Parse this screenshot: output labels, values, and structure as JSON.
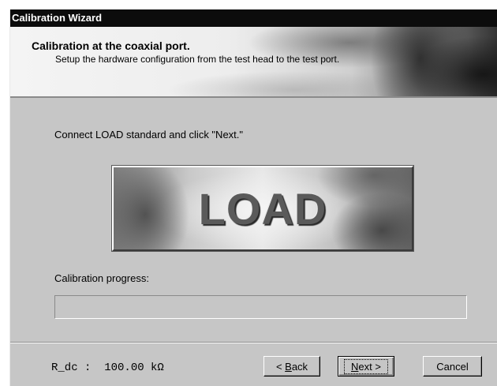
{
  "window": {
    "title": "Calibration Wizard"
  },
  "header": {
    "title": "Calibration at the coaxial port.",
    "subtitle": "Setup the hardware configuration from the test head to the test port."
  },
  "main": {
    "instruction": "Connect LOAD standard and click \"Next.\"",
    "standard_image_text": "LOAD",
    "progress_label": "Calibration progress:",
    "progress_value": 0
  },
  "footer": {
    "status_text": "R_dc :  100.00 kΩ",
    "back_label_prefix": "< ",
    "back_label_key": "B",
    "back_label_rest": "ack",
    "next_label_key": "N",
    "next_label_rest": "ext >",
    "cancel_label": "Cancel"
  },
  "colors": {
    "titlebar": "#0c0c0c",
    "dialog_bg": "#c6c6c6"
  }
}
